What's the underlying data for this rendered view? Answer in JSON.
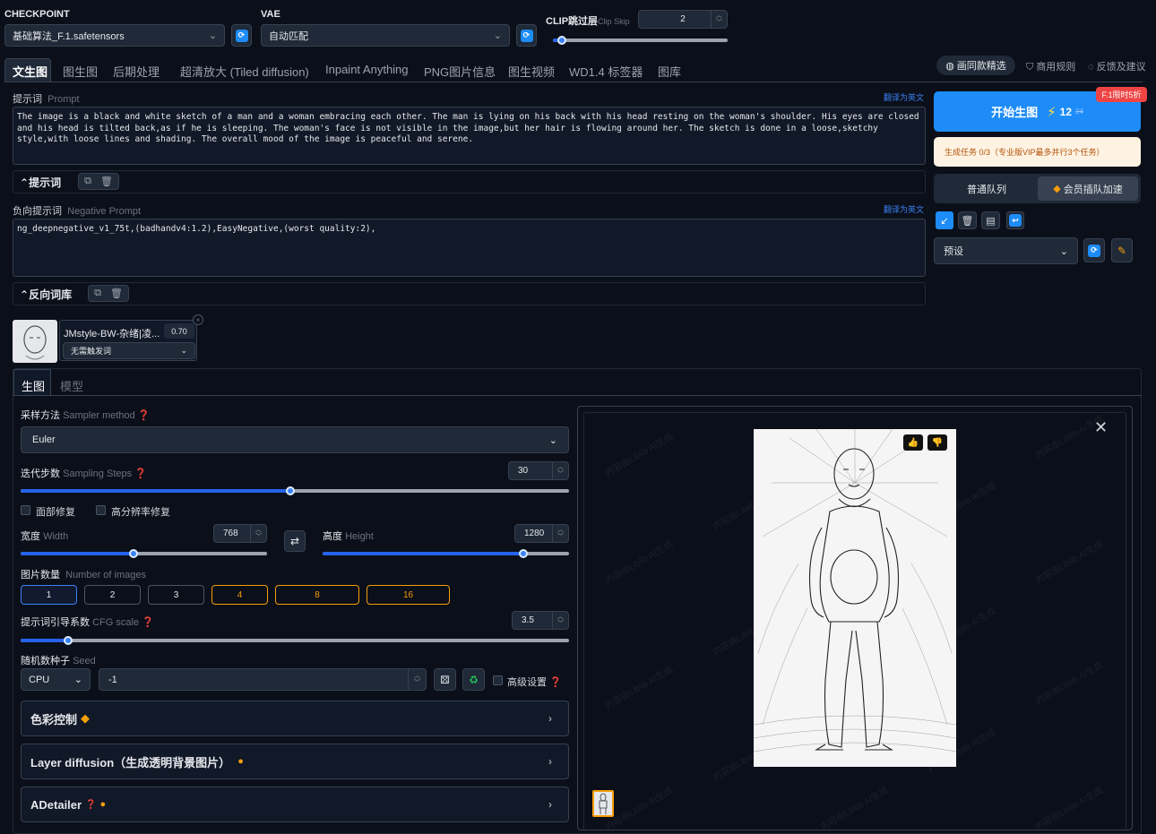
{
  "top": {
    "checkpoint_label": "CHECKPOINT",
    "checkpoint_value": "基础算法_F.1.safetensors",
    "vae_label": "VAE",
    "vae_value": "自动匹配",
    "clip_label": "CLIP跳过层",
    "clip_sub": "Clip Skip",
    "clip_value": "2"
  },
  "tabs": [
    "文生图",
    "图生图",
    "后期处理",
    "超清放大 (Tiled diffusion)",
    "Inpaint Anything",
    "PNG图片信息",
    "图生视频",
    "WD1.4 标签器",
    "图库"
  ],
  "top_right": {
    "gallery_pick": "画同款精选",
    "rules": "商用规则",
    "feedback": "反馈及建议"
  },
  "prompt": {
    "label": "提示词",
    "sub": "Prompt",
    "translate": "翻译为英文",
    "text": "The image is a black and white sketch of a man and a woman embracing each other. The man is lying on his back with his head resting on the woman's shoulder. His eyes are closed and his head is tilted back,as if he is sleeping. The woman's face is not visible in the image,but her hair is flowing around her. The sketch is done in a loose,sketchy style,with loose lines and shading. The overall mood of the image is peaceful and serene.",
    "toolbar_label": "提示词"
  },
  "negative": {
    "label": "负向提示词",
    "sub": "Negative Prompt",
    "translate": "翻译为英文",
    "text": "ng_deepnegative_v1_75t,(badhandv4:1.2),EasyNegative,(worst quality:2),",
    "toolbar_label": "反向词库"
  },
  "lora": {
    "name": "JMstyle-BW-杂绪|凌...",
    "weight": "0.70",
    "trigger": "无需触发词"
  },
  "subtabs": [
    "生图",
    "模型"
  ],
  "sampler": {
    "label": "采样方法",
    "sub": "Sampler method",
    "value": "Euler"
  },
  "steps": {
    "label": "迭代步数",
    "sub": "Sampling Steps",
    "value": "30",
    "fraction": 0.49
  },
  "face_fix": "面部修复",
  "hires_fix": "高分辨率修复",
  "width": {
    "label": "宽度",
    "sub": "Width",
    "value": "768",
    "fraction": 0.45
  },
  "height": {
    "label": "高度",
    "sub": "Height",
    "value": "1280",
    "fraction": 0.81
  },
  "count": {
    "label": "图片数量",
    "sub": "Number of images",
    "options": [
      "1",
      "2",
      "3",
      "4",
      "8",
      "16"
    ]
  },
  "cfg": {
    "label": "提示词引导系数",
    "sub": "CFG scale",
    "value": "3.5",
    "fraction": 0.085
  },
  "seed": {
    "label": "随机数种子",
    "sub": "Seed",
    "device": "CPU",
    "value": "-1",
    "advanced": "高级设置"
  },
  "sections": {
    "color": "色彩控制",
    "layer": "Layer diffusion（生成透明背景图片）",
    "adetailer": "ADetailer"
  },
  "right": {
    "badge": "F.1限时5折",
    "generate": "开始生图",
    "credits": "12",
    "credits_old": "24",
    "task_info": "生成任务 0/3（专业版VIP最多并行3个任务）",
    "queue_normal": "普通队列",
    "queue_vip": "会员插队加速",
    "preset": "预设"
  },
  "watermark": "内容由Liblib AI生成",
  "colors": {
    "accent": "#2563eb",
    "orange": "#f59e0b",
    "badge": "#ef4444"
  }
}
